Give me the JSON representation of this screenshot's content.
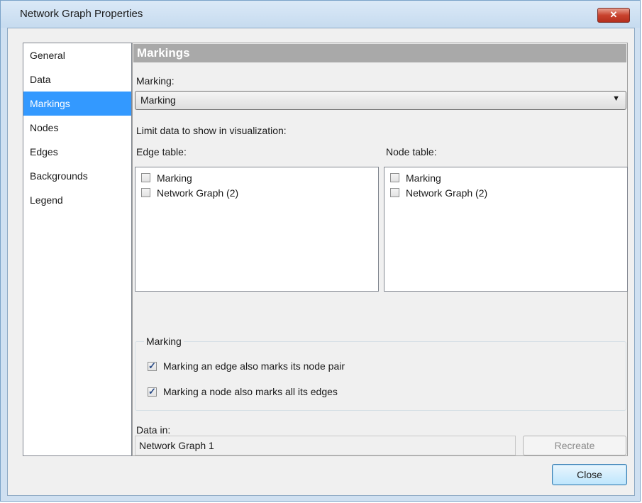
{
  "window": {
    "title": "Network Graph Properties",
    "close_glyph": "✕"
  },
  "nav": {
    "items": [
      "General",
      "Data",
      "Markings",
      "Nodes",
      "Edges",
      "Backgrounds",
      "Legend"
    ],
    "active": "Markings"
  },
  "panel": {
    "header": "Markings",
    "marking_label": "Marking:",
    "marking_value": "Marking",
    "limit_label": "Limit data to show in visualization:",
    "edge_table_label": "Edge table:",
    "node_table_label": "Node table:",
    "edge_items": [
      {
        "label": "Marking",
        "checked": false
      },
      {
        "label": "Network Graph (2)",
        "checked": false
      }
    ],
    "node_items": [
      {
        "label": "Marking",
        "checked": false
      },
      {
        "label": "Network Graph (2)",
        "checked": false
      }
    ],
    "group_title": "Marking",
    "option1": {
      "label": "Marking an edge also marks its node pair",
      "checked": true
    },
    "option2": {
      "label": "Marking a node also marks all its edges",
      "checked": true
    },
    "data_in_label": "Data in:",
    "data_in_value": "Network Graph 1",
    "recreate_label": "Recreate"
  },
  "footer": {
    "close_label": "Close"
  }
}
